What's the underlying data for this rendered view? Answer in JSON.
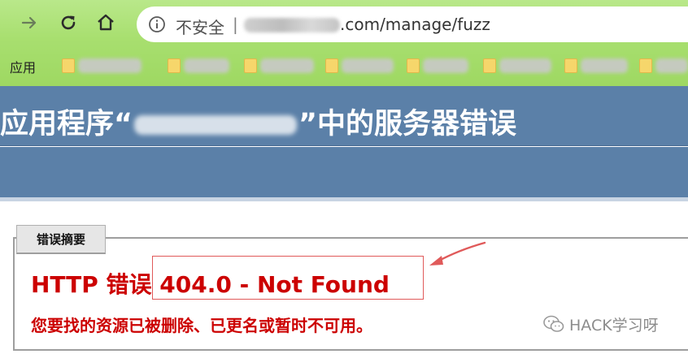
{
  "browser": {
    "address_bar": {
      "security_label": "不安全",
      "separator": "|",
      "url_visible": ".com/manage/fuzz"
    },
    "bookmarks": {
      "apps_label": "应用"
    }
  },
  "page": {
    "title_prefix": "应用程序“",
    "title_suffix": "”中的服务器错误",
    "legend": "错误摘要",
    "http_error_prefix": "HTTP 错误",
    "http_error_code": " 404.0 - Not Found",
    "description": "您要找的资源已被删除、已更名或暂时不可用。"
  },
  "watermark": {
    "text": "HACK学习呀"
  },
  "colors": {
    "chrome_green": "#a8df6f",
    "header_blue": "#5b80a8",
    "error_red": "#cc0000",
    "annotation_red": "#e05a5a"
  },
  "icons": [
    "forward-arrow-icon",
    "reload-icon",
    "home-icon",
    "info-icon",
    "folder-icon",
    "wechat-icon"
  ]
}
